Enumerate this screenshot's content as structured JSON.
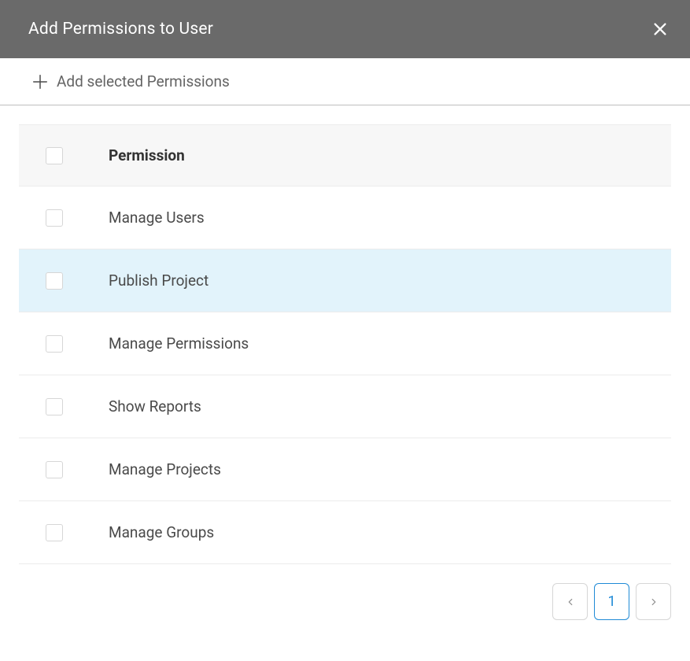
{
  "dialog": {
    "title": "Add Permissions to User",
    "closeIconName": "close-icon"
  },
  "toolbar": {
    "addSelectedLabel": "Add selected Permissions"
  },
  "table": {
    "headerLabel": "Permission",
    "rows": [
      {
        "label": "Manage Users",
        "highlighted": false
      },
      {
        "label": "Publish Project",
        "highlighted": true
      },
      {
        "label": "Manage Permissions",
        "highlighted": false
      },
      {
        "label": "Show Reports",
        "highlighted": false
      },
      {
        "label": "Manage Projects",
        "highlighted": false
      },
      {
        "label": "Manage Groups",
        "highlighted": false
      }
    ]
  },
  "pager": {
    "currentPage": "1"
  }
}
